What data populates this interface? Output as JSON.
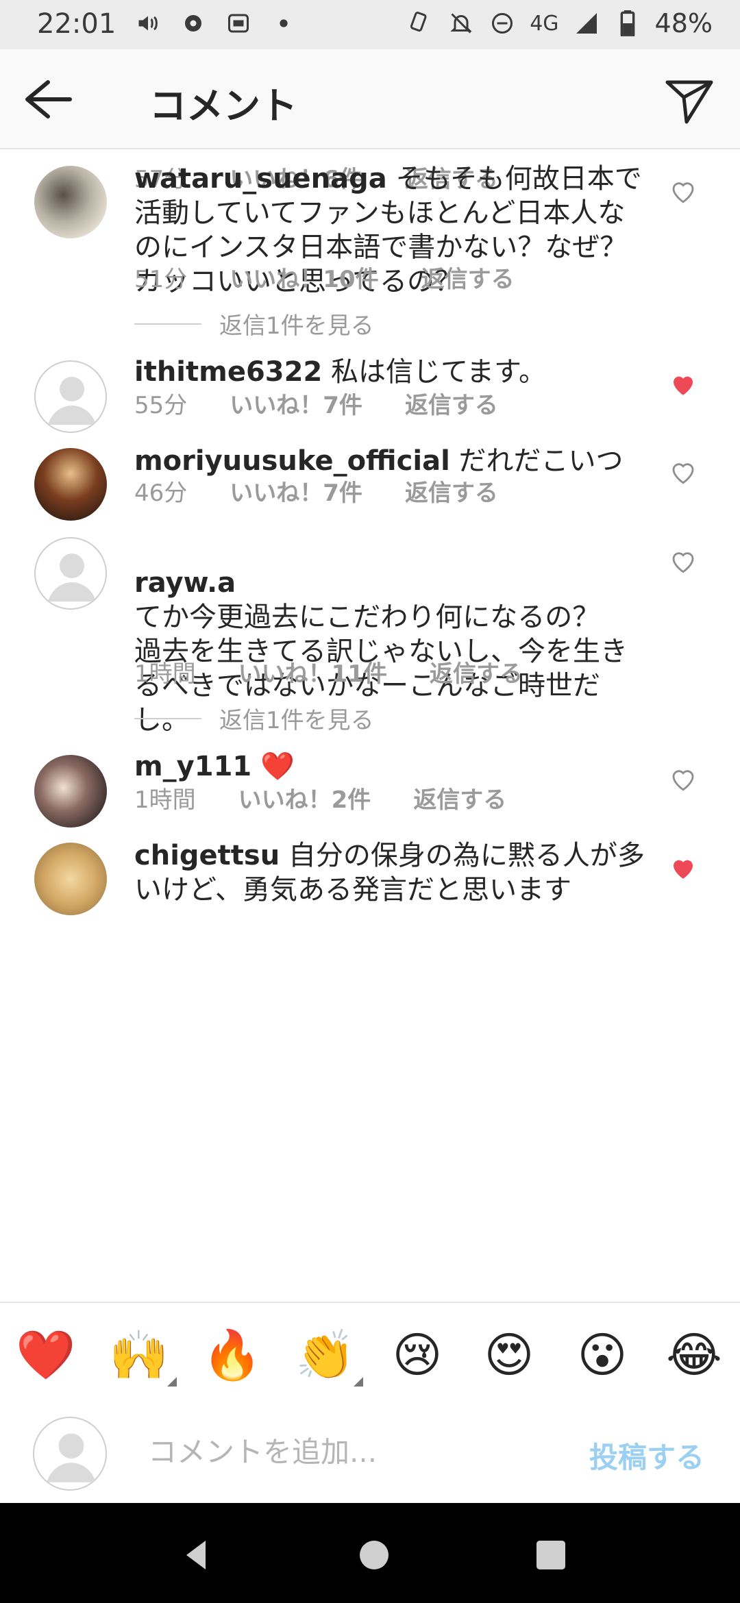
{
  "status_bar": {
    "time": "22:01",
    "network": "4G",
    "battery": "48%",
    "icons": [
      "volume-icon",
      "gear-icon",
      "aupay-icon",
      "dot-icon",
      "nfc-icon",
      "bell-off-icon",
      "dnd-icon",
      "signal-icon",
      "battery-icon"
    ]
  },
  "header": {
    "title": "コメント",
    "back_icon": "back-arrow-icon",
    "send_icon": "send-icon"
  },
  "comments": [
    {
      "username": "",
      "text": "",
      "time": "57分",
      "likes": "いいね！6件",
      "reply": "返信する",
      "liked": false,
      "partial": true
    },
    {
      "username": "wataru_suenaga",
      "text": "そもそも何故日本で活動していてファンもほとんど日本人なのにインスタ日本語で書かない？なぜ？カッコいいと思ってるの？",
      "time": "51分",
      "likes": "いいね！10件",
      "reply": "返信する",
      "liked": false,
      "view_replies": "返信1件を見る"
    },
    {
      "username": "ithitme6322",
      "text": "私は信じてます。",
      "time": "55分",
      "likes": "いいね！7件",
      "reply": "返信する",
      "liked": true
    },
    {
      "username": "moriyuusuke_official",
      "text": "だれだこいつ",
      "time": "46分",
      "likes": "いいね！7件",
      "reply": "返信する",
      "liked": false
    },
    {
      "username": "rayw.a",
      "text": "てか今更過去にこだわり何になるの？\n過去を生きてる訳じゃないし、今を生きるべきではないかなーこんなご時世だし。",
      "time": "1時間",
      "likes": "いいね！11件",
      "reply": "返信する",
      "liked": false,
      "view_replies": "返信1件を見る"
    },
    {
      "username": "m_y111",
      "text": "❤️",
      "time": "1時間",
      "likes": "いいね！2件",
      "reply": "返信する",
      "liked": false
    },
    {
      "username": "chigettsu",
      "text": "自分の保身の為に黙る人が多いけど、勇気ある発言だと思います",
      "liked": true,
      "partial": true
    }
  ],
  "emoji_bar": [
    "❤️",
    "🙌",
    "🔥",
    "👏",
    "😢",
    "😍",
    "😮",
    "😂"
  ],
  "comment_box": {
    "placeholder": "コメントを追加...",
    "post_label": "投稿する"
  },
  "nav_bar": [
    "back-triangle-icon",
    "home-circle-icon",
    "recents-square-icon"
  ],
  "colors": {
    "liked_heart": "#ed4956",
    "post_disabled": "#9cd0f3",
    "meta_gray": "#9a9a9a"
  }
}
